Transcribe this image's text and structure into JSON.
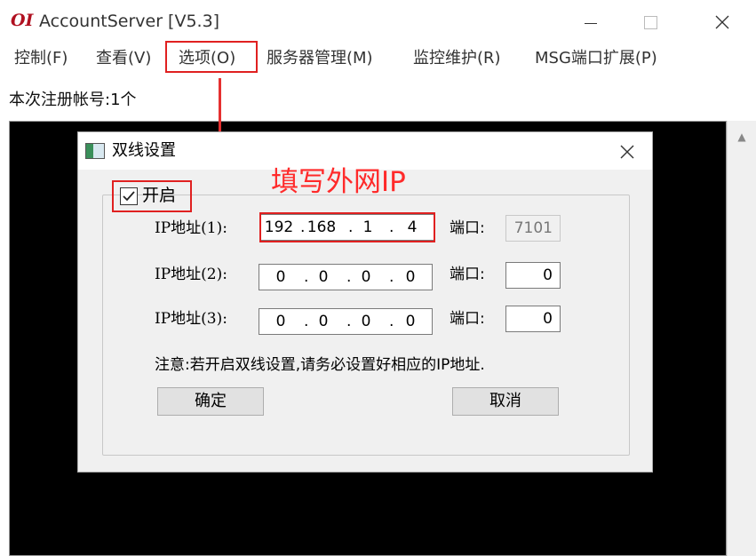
{
  "window": {
    "logo_text": "OI",
    "title": "AccountServer [V5.3]"
  },
  "menu": {
    "items": [
      {
        "label": "控制(F)"
      },
      {
        "label": "查看(V)"
      },
      {
        "label": "选项(O)"
      },
      {
        "label": "服务器管理(M)"
      },
      {
        "label": "监控维护(R)"
      },
      {
        "label": "MSG端口扩展(P)"
      }
    ]
  },
  "status": {
    "registered_accounts": "本次注册帐号:1个"
  },
  "dialog": {
    "title": "双线设置",
    "enable_label": "开启",
    "enable_checked": true,
    "annotation": "填写外网IP",
    "rows": [
      {
        "label": "IP地址(1):",
        "octets": [
          "192",
          "168",
          "1",
          "4"
        ],
        "port_label": "端口:",
        "port": "7101",
        "port_disabled": true
      },
      {
        "label": "IP地址(2):",
        "octets": [
          "0",
          "0",
          "0",
          "0"
        ],
        "port_label": "端口:",
        "port": "0",
        "port_disabled": false
      },
      {
        "label": "IP地址(3):",
        "octets": [
          "0",
          "0",
          "0",
          "0"
        ],
        "port_label": "端口:",
        "port": "0",
        "port_disabled": false
      }
    ],
    "notice": "注意:若开启双线设置,请务必设置好相应的IP地址.",
    "ok_label": "确定",
    "cancel_label": "取消"
  },
  "colors": {
    "highlight": "#e02020",
    "annotation": "#ff2a2a",
    "console_bg": "#000000"
  }
}
